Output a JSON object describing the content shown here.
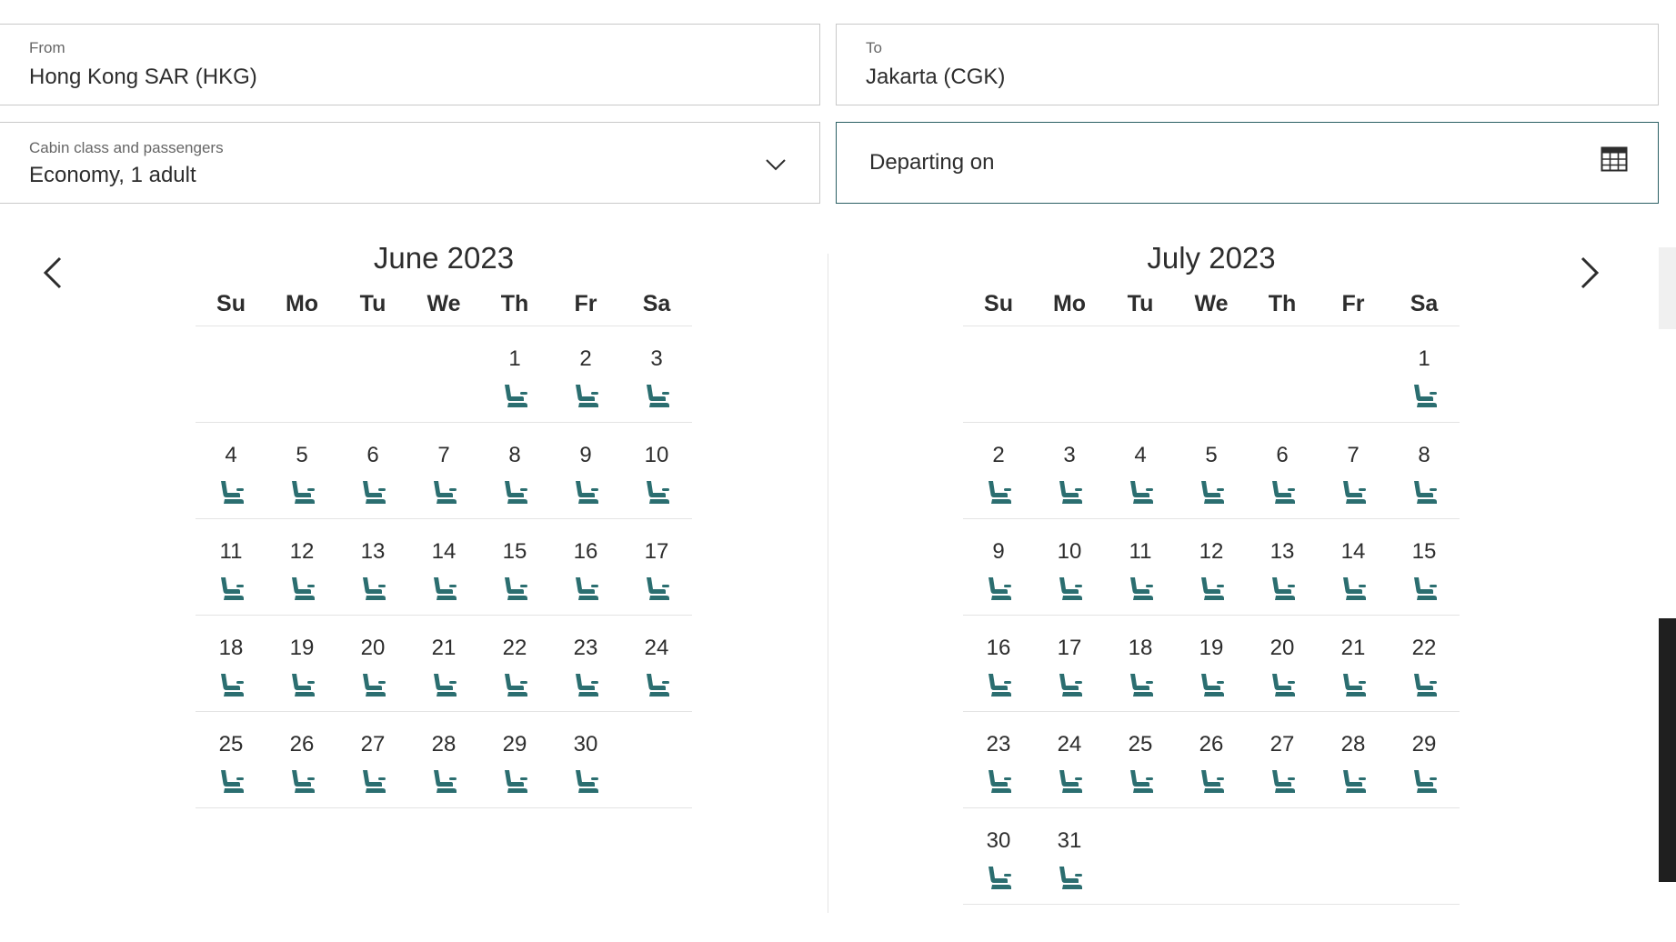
{
  "from": {
    "label": "From",
    "value": "Hong Kong SAR (HKG)"
  },
  "to": {
    "label": "To",
    "value": "Jakarta (CGK)"
  },
  "cabin": {
    "label": "Cabin class and passengers",
    "value": "Economy, 1 adult"
  },
  "departing": {
    "placeholder": "Departing on"
  },
  "colors": {
    "accent": "#2b6e70",
    "seat_icon": "#2b6e70",
    "border": "#c9c9c9"
  },
  "icons": {
    "prev": "chevron-left-icon",
    "next": "chevron-right-icon",
    "dropdown": "chevron-down-icon",
    "calendar": "calendar-icon",
    "seat": "seat-icon"
  },
  "weekdays": [
    "Su",
    "Mo",
    "Tu",
    "We",
    "Th",
    "Fr",
    "Sa"
  ],
  "months": [
    {
      "title": "June 2023",
      "weeks": [
        [
          "",
          "",
          "",
          "",
          "1",
          "2",
          "3"
        ],
        [
          "4",
          "5",
          "6",
          "7",
          "8",
          "9",
          "10"
        ],
        [
          "11",
          "12",
          "13",
          "14",
          "15",
          "16",
          "17"
        ],
        [
          "18",
          "19",
          "20",
          "21",
          "22",
          "23",
          "24"
        ],
        [
          "25",
          "26",
          "27",
          "28",
          "29",
          "30",
          ""
        ]
      ]
    },
    {
      "title": "July 2023",
      "weeks": [
        [
          "",
          "",
          "",
          "",
          "",
          "",
          "1"
        ],
        [
          "2",
          "3",
          "4",
          "5",
          "6",
          "7",
          "8"
        ],
        [
          "9",
          "10",
          "11",
          "12",
          "13",
          "14",
          "15"
        ],
        [
          "16",
          "17",
          "18",
          "19",
          "20",
          "21",
          "22"
        ],
        [
          "23",
          "24",
          "25",
          "26",
          "27",
          "28",
          "29"
        ],
        [
          "30",
          "31",
          "",
          "",
          "",
          "",
          ""
        ]
      ]
    }
  ]
}
